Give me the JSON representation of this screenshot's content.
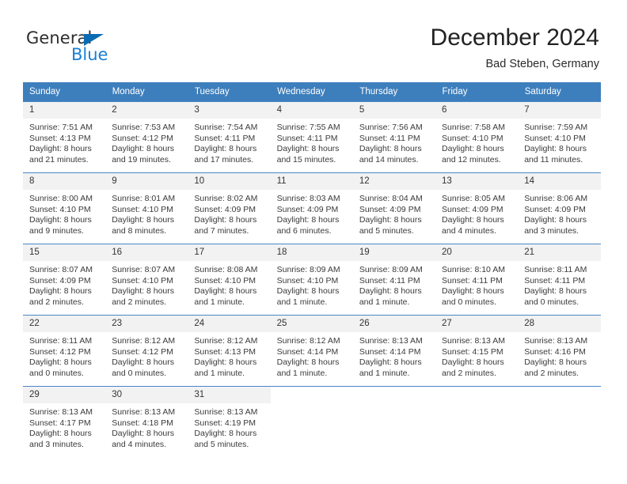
{
  "brand": {
    "name_part1": "General",
    "name_part2": "Blue",
    "triangle_color": "#0b6cb4",
    "blue_color": "#1a7fd4"
  },
  "header": {
    "title": "December 2024",
    "subtitle": "Bad Steben, Germany",
    "header_bg": "#3d7fbd",
    "header_text_color": "#ffffff",
    "daynum_bg": "#f2f2f2",
    "row_divider_color": "#4a87c4"
  },
  "weekdays": [
    "Sunday",
    "Monday",
    "Tuesday",
    "Wednesday",
    "Thursday",
    "Friday",
    "Saturday"
  ],
  "labels": {
    "sunrise_prefix": "Sunrise: ",
    "sunset_prefix": "Sunset: ",
    "daylight_prefix": "Daylight: "
  },
  "weeks": [
    [
      {
        "day": "1",
        "sunrise": "Sunrise: 7:51 AM",
        "sunset": "Sunset: 4:13 PM",
        "daylight_line1": "Daylight: 8 hours",
        "daylight_line2": "and 21 minutes."
      },
      {
        "day": "2",
        "sunrise": "Sunrise: 7:53 AM",
        "sunset": "Sunset: 4:12 PM",
        "daylight_line1": "Daylight: 8 hours",
        "daylight_line2": "and 19 minutes."
      },
      {
        "day": "3",
        "sunrise": "Sunrise: 7:54 AM",
        "sunset": "Sunset: 4:11 PM",
        "daylight_line1": "Daylight: 8 hours",
        "daylight_line2": "and 17 minutes."
      },
      {
        "day": "4",
        "sunrise": "Sunrise: 7:55 AM",
        "sunset": "Sunset: 4:11 PM",
        "daylight_line1": "Daylight: 8 hours",
        "daylight_line2": "and 15 minutes."
      },
      {
        "day": "5",
        "sunrise": "Sunrise: 7:56 AM",
        "sunset": "Sunset: 4:11 PM",
        "daylight_line1": "Daylight: 8 hours",
        "daylight_line2": "and 14 minutes."
      },
      {
        "day": "6",
        "sunrise": "Sunrise: 7:58 AM",
        "sunset": "Sunset: 4:10 PM",
        "daylight_line1": "Daylight: 8 hours",
        "daylight_line2": "and 12 minutes."
      },
      {
        "day": "7",
        "sunrise": "Sunrise: 7:59 AM",
        "sunset": "Sunset: 4:10 PM",
        "daylight_line1": "Daylight: 8 hours",
        "daylight_line2": "and 11 minutes."
      }
    ],
    [
      {
        "day": "8",
        "sunrise": "Sunrise: 8:00 AM",
        "sunset": "Sunset: 4:10 PM",
        "daylight_line1": "Daylight: 8 hours",
        "daylight_line2": "and 9 minutes."
      },
      {
        "day": "9",
        "sunrise": "Sunrise: 8:01 AM",
        "sunset": "Sunset: 4:10 PM",
        "daylight_line1": "Daylight: 8 hours",
        "daylight_line2": "and 8 minutes."
      },
      {
        "day": "10",
        "sunrise": "Sunrise: 8:02 AM",
        "sunset": "Sunset: 4:09 PM",
        "daylight_line1": "Daylight: 8 hours",
        "daylight_line2": "and 7 minutes."
      },
      {
        "day": "11",
        "sunrise": "Sunrise: 8:03 AM",
        "sunset": "Sunset: 4:09 PM",
        "daylight_line1": "Daylight: 8 hours",
        "daylight_line2": "and 6 minutes."
      },
      {
        "day": "12",
        "sunrise": "Sunrise: 8:04 AM",
        "sunset": "Sunset: 4:09 PM",
        "daylight_line1": "Daylight: 8 hours",
        "daylight_line2": "and 5 minutes."
      },
      {
        "day": "13",
        "sunrise": "Sunrise: 8:05 AM",
        "sunset": "Sunset: 4:09 PM",
        "daylight_line1": "Daylight: 8 hours",
        "daylight_line2": "and 4 minutes."
      },
      {
        "day": "14",
        "sunrise": "Sunrise: 8:06 AM",
        "sunset": "Sunset: 4:09 PM",
        "daylight_line1": "Daylight: 8 hours",
        "daylight_line2": "and 3 minutes."
      }
    ],
    [
      {
        "day": "15",
        "sunrise": "Sunrise: 8:07 AM",
        "sunset": "Sunset: 4:09 PM",
        "daylight_line1": "Daylight: 8 hours",
        "daylight_line2": "and 2 minutes."
      },
      {
        "day": "16",
        "sunrise": "Sunrise: 8:07 AM",
        "sunset": "Sunset: 4:10 PM",
        "daylight_line1": "Daylight: 8 hours",
        "daylight_line2": "and 2 minutes."
      },
      {
        "day": "17",
        "sunrise": "Sunrise: 8:08 AM",
        "sunset": "Sunset: 4:10 PM",
        "daylight_line1": "Daylight: 8 hours",
        "daylight_line2": "and 1 minute."
      },
      {
        "day": "18",
        "sunrise": "Sunrise: 8:09 AM",
        "sunset": "Sunset: 4:10 PM",
        "daylight_line1": "Daylight: 8 hours",
        "daylight_line2": "and 1 minute."
      },
      {
        "day": "19",
        "sunrise": "Sunrise: 8:09 AM",
        "sunset": "Sunset: 4:11 PM",
        "daylight_line1": "Daylight: 8 hours",
        "daylight_line2": "and 1 minute."
      },
      {
        "day": "20",
        "sunrise": "Sunrise: 8:10 AM",
        "sunset": "Sunset: 4:11 PM",
        "daylight_line1": "Daylight: 8 hours",
        "daylight_line2": "and 0 minutes."
      },
      {
        "day": "21",
        "sunrise": "Sunrise: 8:11 AM",
        "sunset": "Sunset: 4:11 PM",
        "daylight_line1": "Daylight: 8 hours",
        "daylight_line2": "and 0 minutes."
      }
    ],
    [
      {
        "day": "22",
        "sunrise": "Sunrise: 8:11 AM",
        "sunset": "Sunset: 4:12 PM",
        "daylight_line1": "Daylight: 8 hours",
        "daylight_line2": "and 0 minutes."
      },
      {
        "day": "23",
        "sunrise": "Sunrise: 8:12 AM",
        "sunset": "Sunset: 4:12 PM",
        "daylight_line1": "Daylight: 8 hours",
        "daylight_line2": "and 0 minutes."
      },
      {
        "day": "24",
        "sunrise": "Sunrise: 8:12 AM",
        "sunset": "Sunset: 4:13 PM",
        "daylight_line1": "Daylight: 8 hours",
        "daylight_line2": "and 1 minute."
      },
      {
        "day": "25",
        "sunrise": "Sunrise: 8:12 AM",
        "sunset": "Sunset: 4:14 PM",
        "daylight_line1": "Daylight: 8 hours",
        "daylight_line2": "and 1 minute."
      },
      {
        "day": "26",
        "sunrise": "Sunrise: 8:13 AM",
        "sunset": "Sunset: 4:14 PM",
        "daylight_line1": "Daylight: 8 hours",
        "daylight_line2": "and 1 minute."
      },
      {
        "day": "27",
        "sunrise": "Sunrise: 8:13 AM",
        "sunset": "Sunset: 4:15 PM",
        "daylight_line1": "Daylight: 8 hours",
        "daylight_line2": "and 2 minutes."
      },
      {
        "day": "28",
        "sunrise": "Sunrise: 8:13 AM",
        "sunset": "Sunset: 4:16 PM",
        "daylight_line1": "Daylight: 8 hours",
        "daylight_line2": "and 2 minutes."
      }
    ],
    [
      {
        "day": "29",
        "sunrise": "Sunrise: 8:13 AM",
        "sunset": "Sunset: 4:17 PM",
        "daylight_line1": "Daylight: 8 hours",
        "daylight_line2": "and 3 minutes."
      },
      {
        "day": "30",
        "sunrise": "Sunrise: 8:13 AM",
        "sunset": "Sunset: 4:18 PM",
        "daylight_line1": "Daylight: 8 hours",
        "daylight_line2": "and 4 minutes."
      },
      {
        "day": "31",
        "sunrise": "Sunrise: 8:13 AM",
        "sunset": "Sunset: 4:19 PM",
        "daylight_line1": "Daylight: 8 hours",
        "daylight_line2": "and 5 minutes."
      },
      {
        "day": "",
        "sunrise": "",
        "sunset": "",
        "daylight_line1": "",
        "daylight_line2": ""
      },
      {
        "day": "",
        "sunrise": "",
        "sunset": "",
        "daylight_line1": "",
        "daylight_line2": ""
      },
      {
        "day": "",
        "sunrise": "",
        "sunset": "",
        "daylight_line1": "",
        "daylight_line2": ""
      },
      {
        "day": "",
        "sunrise": "",
        "sunset": "",
        "daylight_line1": "",
        "daylight_line2": ""
      }
    ]
  ]
}
